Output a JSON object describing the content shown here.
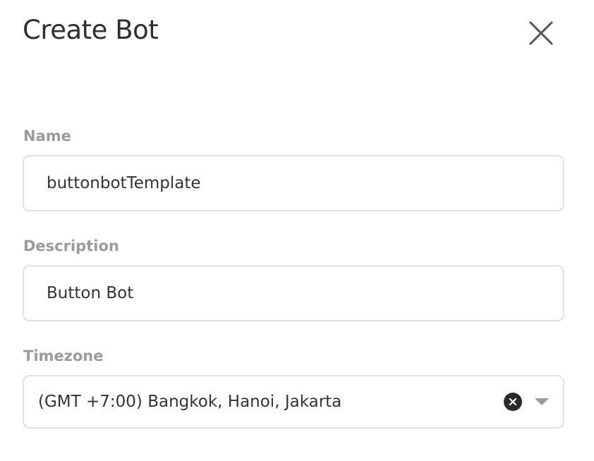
{
  "dialog": {
    "title": "Create Bot",
    "close_icon": "close-icon"
  },
  "form": {
    "name": {
      "label": "Name",
      "value": "buttonbotTemplate"
    },
    "description": {
      "label": "Description",
      "value": "Button Bot"
    },
    "timezone": {
      "label": "Timezone",
      "selected": "(GMT +7:00) Bangkok, Hanoi, Jakarta",
      "clear_icon": "clear-icon",
      "dropdown_icon": "chevron-down-icon"
    }
  },
  "colors": {
    "label_gray": "#9b9b9b",
    "border_gray": "#e1e1e1",
    "text_dark": "#333333",
    "clear_button": "#2b2b2b"
  }
}
